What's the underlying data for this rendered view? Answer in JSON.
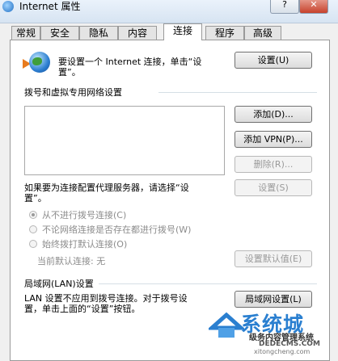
{
  "window": {
    "title": "Internet 属性",
    "help_btn": "?",
    "close_btn": "✕"
  },
  "tabs": [
    {
      "label": "常规",
      "active": false
    },
    {
      "label": "安全",
      "active": false
    },
    {
      "label": "隐私",
      "active": false
    },
    {
      "label": "内容",
      "active": false
    },
    {
      "label": "连接",
      "active": true
    },
    {
      "label": "程序",
      "active": false
    },
    {
      "label": "高级",
      "active": false
    }
  ],
  "setup": {
    "text_line1": "要设置一个 Internet 连接，单击“设",
    "text_line2": "置”。",
    "button": "设置(U)"
  },
  "dialup": {
    "heading": "拨号和虚拟专用网络设置",
    "add_button": "添加(D)...",
    "add_vpn_button": "添加 VPN(P)...",
    "delete_button": "删除(R)...",
    "proxy_text_line1": "如果要为连接配置代理服务器，请选择“设",
    "proxy_text_line2": "置”。",
    "settings_button": "设置(S)",
    "radio_never": "从不进行拨号连接(C)",
    "radio_when_no_network": "不论网络连接是否存在都进行拨号(W)",
    "radio_always": "始终拨打默认连接(O)",
    "current_default": "当前默认连接:  无",
    "set_default_button": "设置默认值(E)"
  },
  "lan": {
    "heading": "局域网(LAN)设置",
    "text_line1": "LAN 设置不应用到拨号连接。对于拨号设",
    "text_line2": "置，单击上面的“设置”按钮。",
    "button": "局域网设置(L)"
  },
  "watermark": {
    "big": "系统城",
    "sub": "级务内容管理系统",
    "url": "DEDECMS.COM",
    "url2": "xitongcheng.com"
  },
  "colors": {
    "accent": "#2a7fd0",
    "panel_bg": "#ffffff",
    "window_bg": "#f0f0f0"
  }
}
